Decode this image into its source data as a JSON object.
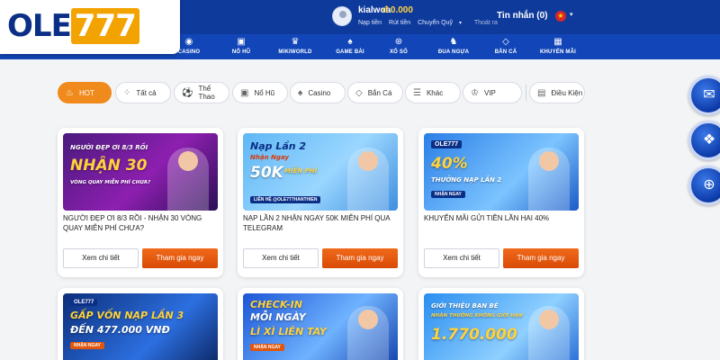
{
  "brand": {
    "logo_part1": "OLE",
    "logo_part2": "777"
  },
  "user": {
    "username": "kialwoa",
    "balance": "đ 0.000"
  },
  "account_links": {
    "deposit": "Nạp tiền",
    "withdraw": "Rút tiền",
    "transfer": "Chuyển Quỹ",
    "logout": "Thoát ra"
  },
  "messages": "Tin nhắn (0)",
  "nav": [
    {
      "label": "CASINO",
      "icon": "chip-icon"
    },
    {
      "label": "NỔ HŨ",
      "icon": "slot-machine-icon"
    },
    {
      "label": "MIKIWORLD",
      "icon": "mikiworld-icon"
    },
    {
      "label": "GAME BÀI",
      "icon": "cards-icon"
    },
    {
      "label": "XỔ SỐ",
      "icon": "lottery-ball-icon"
    },
    {
      "label": "ĐUA NGỰA",
      "icon": "horse-icon"
    },
    {
      "label": "BẮN CÁ",
      "icon": "fish-icon"
    },
    {
      "label": "KHUYẾN MÃI",
      "icon": "gift-icon"
    }
  ],
  "filters": [
    {
      "label": "HOT",
      "icon": "flame-icon",
      "active": true
    },
    {
      "label": "Tất cả",
      "icon": "grid-icon"
    },
    {
      "label": "Thể Thao",
      "icon": "soccer-ball-icon"
    },
    {
      "label": "Nổ Hũ",
      "icon": "slot-machine-icon"
    },
    {
      "label": "Casino",
      "icon": "cards-icon"
    },
    {
      "label": "Bắn Cá",
      "icon": "fish-icon"
    },
    {
      "label": "Khác",
      "icon": "menu-icon"
    },
    {
      "label": "VIP",
      "icon": "crown-icon"
    },
    {
      "label": "Điều Kiện",
      "icon": "document-icon"
    }
  ],
  "promos": [
    {
      "title": "NGƯỜI ĐẸP ƠI 8/3 RỒI - NHẬN 30 VÒNG QUAY MIỄN PHÍ CHƯA?",
      "banner_lines": [
        "NGƯỜI ĐẸP ƠI 8/3 RỒI",
        "NHẬN 30",
        "VÒNG QUAY MIỄN PHÍ CHƯA?"
      ]
    },
    {
      "title": "NẠP LẦN 2 NHẬN NGAY 50K MIỄN PHÍ QUA TELEGRAM",
      "banner_lines": [
        "Nạp Lần 2",
        "Nhận Ngay",
        "50K",
        "MIỄN PHÍ",
        "LIÊN HỆ @OLE777HANTHIEN"
      ]
    },
    {
      "title": "KHUYẾN MÃI GỬI TIỀN LẦN HAI 40%",
      "banner_lines": [
        "OLE777",
        "40%",
        "THƯỞNG NẠP LẦN 2",
        "NHẬN NGAY"
      ]
    }
  ],
  "promos_row2": [
    {
      "banner_lines": [
        "OLE777",
        "GẤP VỐN NẠP LẦN 3",
        "ĐẾN 477.000 VNĐ",
        "NHẬN NGAY"
      ]
    },
    {
      "banner_lines": [
        "CHECK-IN",
        "MỖI NGÀY",
        "LÌ XÌ LIÊN TAY",
        "NHẬN NGAY"
      ]
    },
    {
      "banner_lines": [
        "GIỚI THIỆU BẠN BÈ",
        "NHẬN THƯỞNG KHÔNG GIỚI HẠN",
        "1.770.000"
      ]
    }
  ],
  "buttons": {
    "detail": "Xem chi tiết",
    "join": "Tham gia ngay"
  },
  "side_buttons": [
    {
      "icon": "mail-icon"
    },
    {
      "icon": "chat-icon"
    },
    {
      "icon": "globe-icon"
    }
  ],
  "colors": {
    "header": "#0e3a9c",
    "nav": "#1246b8",
    "accent": "#f08a1c",
    "join_button": "#e0560c",
    "balance": "#ffd23c"
  }
}
